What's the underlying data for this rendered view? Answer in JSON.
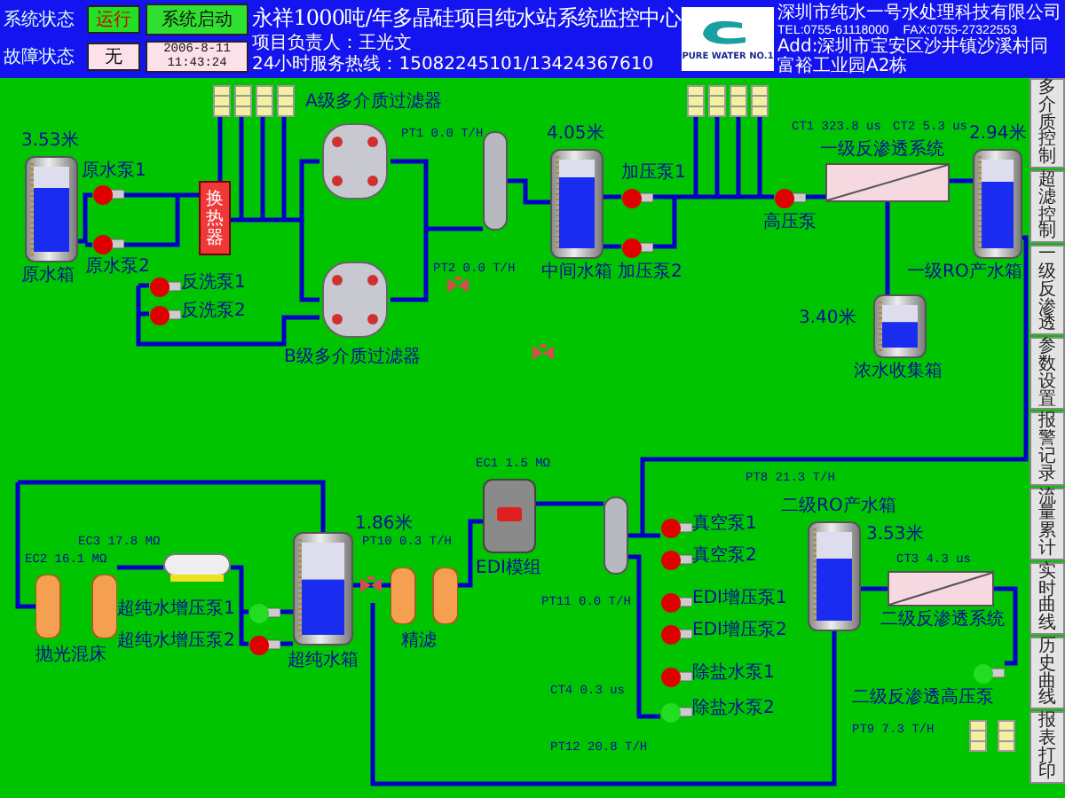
{
  "header": {
    "status_label": "系统状态",
    "status_value": "运行",
    "fault_label": "故障状态",
    "fault_value": "无",
    "start_button": "系统启动",
    "date": "2006-8-11",
    "time": "11:43:24",
    "title": "永祥1000吨/年多晶硅项目纯水站系统监控中心",
    "manager": "项目负责人：王光文",
    "hotline": "24小时服务热线：15082245101/13424367610",
    "logo_text": "PURE WATER NO.1",
    "company": "深圳市纯水一号水处理科技有限公司",
    "tel": "TEL:0755-61118000",
    "fax": "FAX:0755-27322553",
    "address": "Add:深圳市宝安区沙井镇沙溪村同富裕工业园A2栋"
  },
  "tanks": [
    {
      "label": "原水箱",
      "reading": "3.53米",
      "level": 0.75
    },
    {
      "label": "中间水箱",
      "reading": "4.05米",
      "level": 0.8
    },
    {
      "label": "一级RO产水箱",
      "reading": "2.94米",
      "level": 0.75
    },
    {
      "label": "浓水收集箱",
      "reading": "3.40米",
      "level": 0.6
    },
    {
      "label": "超纯水箱",
      "reading": "1.86米",
      "level": 0.6
    },
    {
      "label": "二级RO产水箱",
      "reading": "3.53米",
      "level": 0.7
    }
  ],
  "pumps": [
    {
      "label": "原水泵1",
      "on": false
    },
    {
      "label": "原水泵2",
      "on": false
    },
    {
      "label": "反洗泵1",
      "on": false
    },
    {
      "label": "反洗泵2",
      "on": false
    },
    {
      "label": "加压泵1",
      "on": false
    },
    {
      "label": "加压泵2",
      "on": false
    },
    {
      "label": "高压泵",
      "on": false
    },
    {
      "label": "超纯水增压泵1",
      "on": true
    },
    {
      "label": "超纯水增压泵2",
      "on": false
    },
    {
      "label": "真空泵1",
      "on": false
    },
    {
      "label": "真空泵2",
      "on": false
    },
    {
      "label": "EDI增压泵1",
      "on": false
    },
    {
      "label": "EDI增压泵2",
      "on": false
    },
    {
      "label": "除盐水泵1",
      "on": false
    },
    {
      "label": "除盐水泵2",
      "on": true
    },
    {
      "label": "二级反渗透高压泵",
      "on": true
    }
  ],
  "units": [
    {
      "kind": "filter",
      "label": "A级多介质过滤器"
    },
    {
      "kind": "filter",
      "label": "B级多介质过滤器"
    },
    {
      "kind": "heater",
      "label": "换热器"
    },
    {
      "kind": "membrane",
      "label": "一级反渗透系统"
    },
    {
      "kind": "membrane",
      "label": "二级反渗透系统"
    },
    {
      "kind": "columns",
      "label": "抛光混床"
    },
    {
      "kind": "columns",
      "label": "精滤"
    },
    {
      "kind": "edi",
      "label": "EDI模组"
    }
  ],
  "readings": [
    {
      "tag": "PT1",
      "value": "0.0 T/H"
    },
    {
      "tag": "PT2",
      "value": "0.0 T/H"
    },
    {
      "tag": "CT1",
      "value": "323.8 us"
    },
    {
      "tag": "CT2",
      "value": "5.3 us"
    },
    {
      "tag": "EC1",
      "value": "1.5 MΩ"
    },
    {
      "tag": "PT10",
      "value": "0.3 T/H"
    },
    {
      "tag": "PT11",
      "value": "0.0 T/H"
    },
    {
      "tag": "EC2",
      "value": "16.1 MΩ"
    },
    {
      "tag": "EC3",
      "value": "17.8 MΩ"
    },
    {
      "tag": "PT8",
      "value": "21.3 T/H"
    },
    {
      "tag": "CT3",
      "value": "4.3 us"
    },
    {
      "tag": "PT9",
      "value": "7.3 T/H"
    },
    {
      "tag": "CT4",
      "value": "0.3 us"
    },
    {
      "tag": "PT12",
      "value": "20.8 T/H"
    }
  ],
  "sidebar": [
    {
      "label": "多介质控制",
      "selected": false
    },
    {
      "label": "超滤控制",
      "selected": false
    },
    {
      "label": "一级反渗透",
      "selected": false
    },
    {
      "label": "参数设置",
      "selected": false
    },
    {
      "label": "报警记录",
      "selected": false
    },
    {
      "label": "流量累计",
      "selected": false
    },
    {
      "label": "实时曲线",
      "selected": false
    },
    {
      "label": "历史曲线",
      "selected": false
    },
    {
      "label": "报表打印",
      "selected": false
    }
  ]
}
